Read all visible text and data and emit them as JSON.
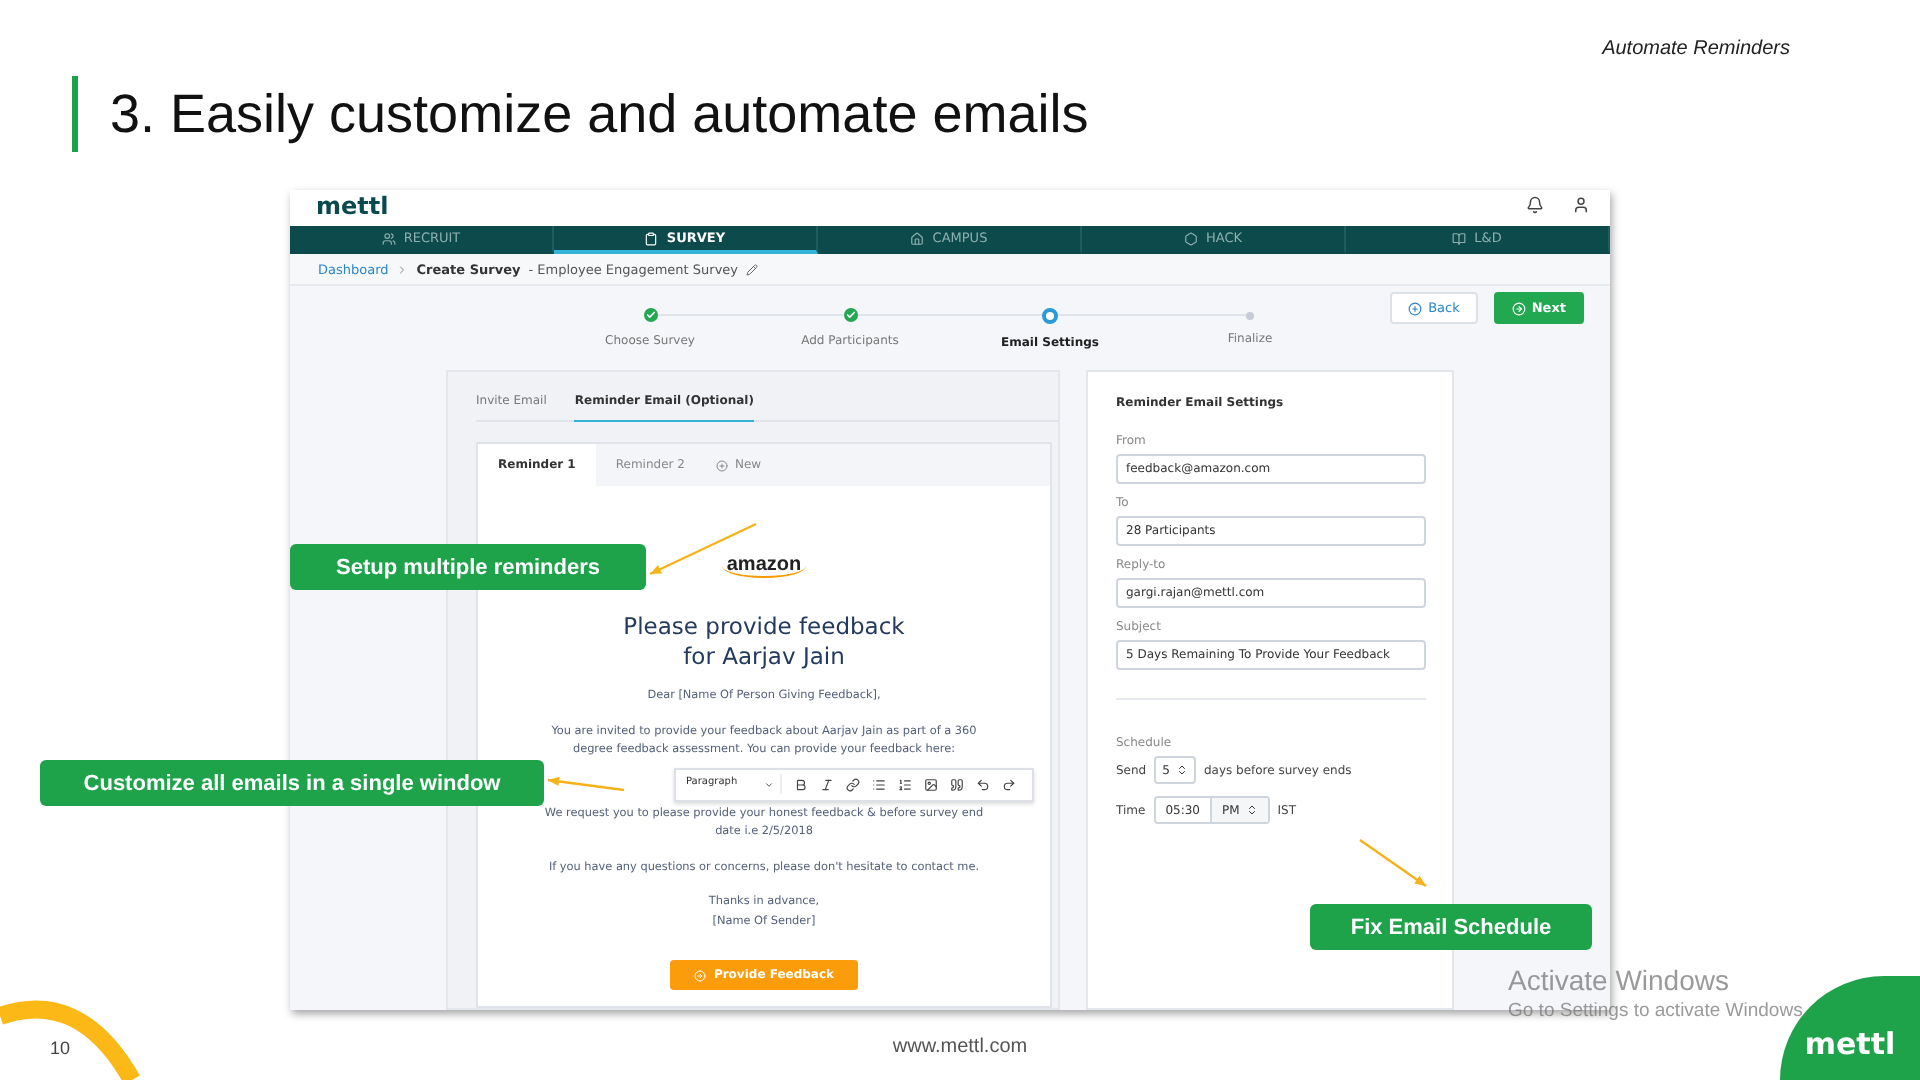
{
  "slide": {
    "section_label": "Automate Reminders",
    "title": "3. Easily customize and automate emails",
    "page_number": "10",
    "footer_url": "www.mettl.com",
    "corner_logo": "mettl"
  },
  "app": {
    "logo": "mettl",
    "nav": [
      {
        "label": "RECRUIT",
        "selected": false
      },
      {
        "label": "SURVEY",
        "selected": true
      },
      {
        "label": "CAMPUS",
        "selected": false
      },
      {
        "label": "HACK",
        "selected": false
      },
      {
        "label": "L&D",
        "selected": false
      }
    ],
    "breadcrumb": {
      "root": "Dashboard",
      "page": "Create Survey",
      "survey": "- Employee Engagement Survey"
    },
    "buttons": {
      "back": "Back",
      "next": "Next"
    },
    "steps": [
      {
        "label": "Choose Survey",
        "done": true,
        "selected": false
      },
      {
        "label": "Add Participants",
        "done": true,
        "selected": false
      },
      {
        "label": "Email Settings",
        "done": false,
        "selected": true
      },
      {
        "label": "Finalize",
        "done": false,
        "selected": false
      }
    ],
    "email_tabs": [
      {
        "label": "Invite Email",
        "selected": false
      },
      {
        "label": "Reminder Email (Optional)",
        "selected": true
      }
    ],
    "reminder_tabs": [
      {
        "label": "Reminder 1",
        "selected": true
      },
      {
        "label": "Reminder 2",
        "selected": false
      }
    ],
    "new_tab": "New",
    "email": {
      "brand": "amazon",
      "heading": [
        "Please provide feedback",
        "for Aarjav Jain"
      ],
      "greeting": "Dear [Name Of Person Giving Feedback],",
      "invite": "You are invited to provide your feedback about Aarjav Jain as part of a 360 degree feedback assessment. You can provide your feedback here:",
      "request": "We request you to please provide your honest feedback & before survey end date i.e 2/5/2018",
      "questions": "If you have any questions or concerns, please don't hesitate to contact me.",
      "signoff": [
        "Thanks in advance,",
        "[Name Of Sender]"
      ],
      "button": "Provide Feedback",
      "toolbar_format": "Paragraph"
    },
    "settings": {
      "title": "Reminder Email Settings",
      "fields": [
        {
          "label": "From",
          "value": "feedback@amazon.com"
        },
        {
          "label": "To",
          "value": "28 Participants"
        },
        {
          "label": "Reply-to",
          "value": "gargi.rajan@mettl.com"
        },
        {
          "label": "Subject",
          "value": "5 Days Remaining To Provide Your Feedback"
        }
      ],
      "schedule_label": "Schedule",
      "send_label": "Send",
      "days": "5",
      "send_suffix": "days before survey ends",
      "time_label": "Time",
      "time": "05:30",
      "meridiem": "PM",
      "timezone": "IST"
    }
  },
  "callouts": [
    {
      "text": "Setup multiple reminders"
    },
    {
      "text": "Customize all emails in a single window"
    },
    {
      "text": "Fix Email Schedule"
    }
  ],
  "os_notice": {
    "title": "Activate Windows",
    "subtitle": "Go to Settings to activate Windows."
  }
}
